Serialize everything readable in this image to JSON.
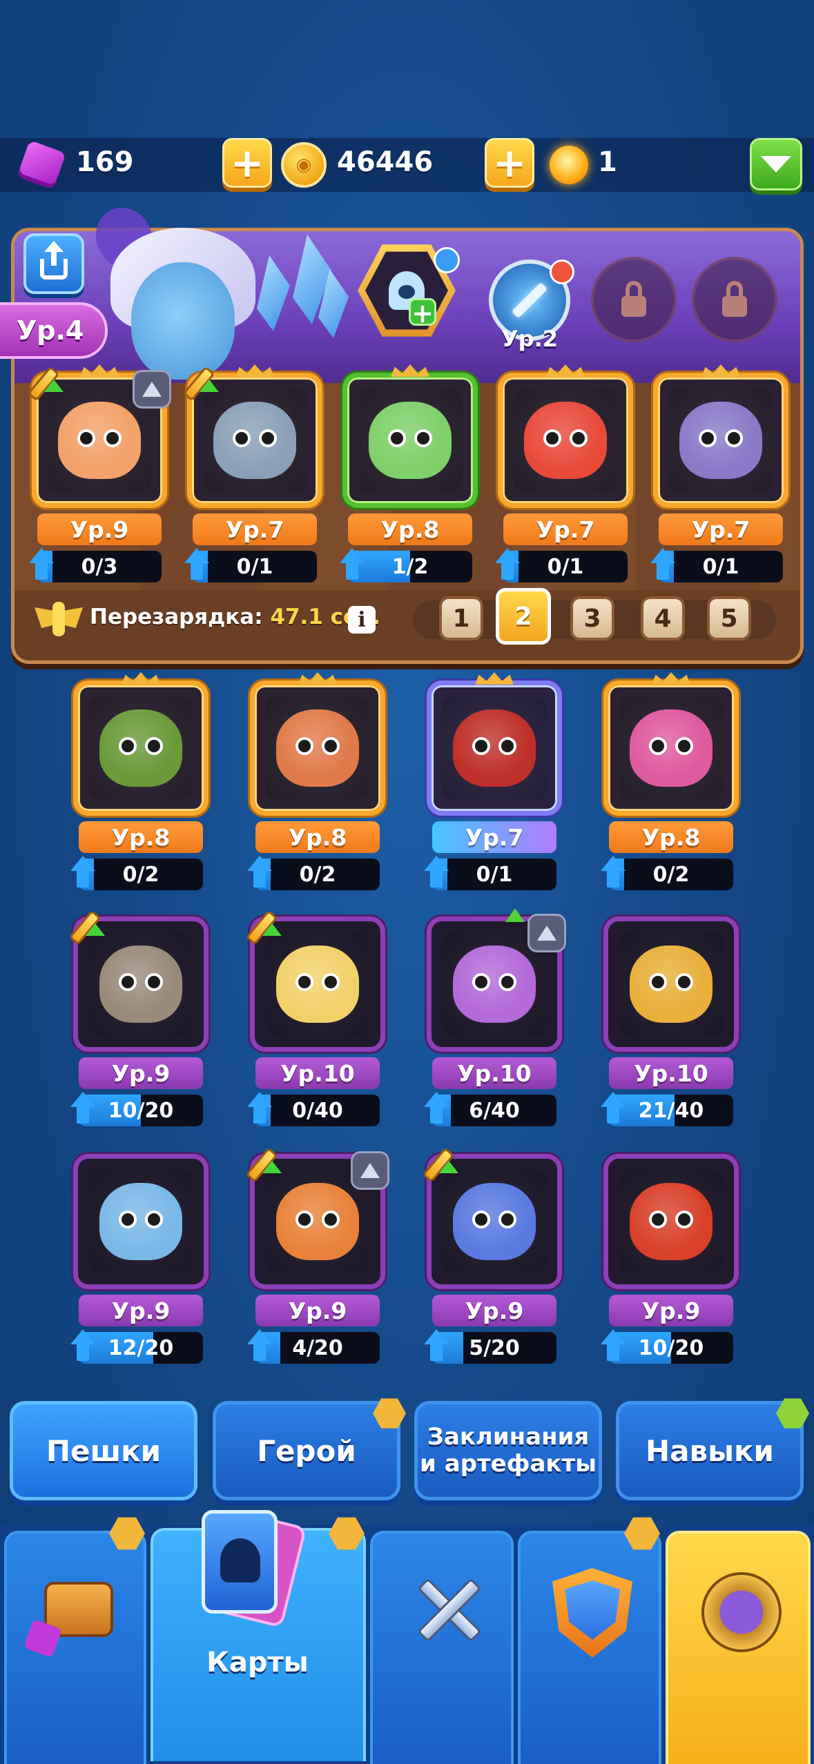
{
  "resources": {
    "gems": "169",
    "coins": "46446",
    "potions": "1"
  },
  "icons": {
    "gem": "gem-icon",
    "coin": "coin-icon",
    "potion": "potion-icon",
    "menu": "chevron-down-icon",
    "share": "share-icon",
    "lock": "lock-icon",
    "cooldown": "winged-emblem-icon"
  },
  "hero": {
    "level": "Ур.4",
    "slot_level": "Ур.2"
  },
  "deck_units": [
    {
      "level": "Ур.9",
      "progress": "0/3",
      "fraction": 0.0,
      "frame": "orange"
    },
    {
      "level": "Ур.7",
      "progress": "0/1",
      "fraction": 0.0,
      "frame": "orange"
    },
    {
      "level": "Ур.8",
      "progress": "1/2",
      "fraction": 0.5,
      "frame": "green"
    },
    {
      "level": "Ур.7",
      "progress": "0/1",
      "fraction": 0.0,
      "frame": "orange"
    },
    {
      "level": "Ур.7",
      "progress": "0/1",
      "fraction": 0.0,
      "frame": "orange"
    }
  ],
  "cooldown": {
    "label": "Перезарядка:",
    "value": "47.1 сек.",
    "info": "i"
  },
  "deck_tabs": [
    "1",
    "2",
    "3",
    "4",
    "5"
  ],
  "active_deck_tab": "2",
  "collection": [
    [
      {
        "level": "Ур.8",
        "progress": "0/2",
        "fraction": 0.0,
        "frame": "orange"
      },
      {
        "level": "Ур.8",
        "progress": "0/2",
        "fraction": 0.0,
        "frame": "orange"
      },
      {
        "level": "Ур.7",
        "progress": "0/1",
        "fraction": 0.0,
        "frame": "blue"
      },
      {
        "level": "Ур.8",
        "progress": "0/2",
        "fraction": 0.0,
        "frame": "orange"
      }
    ],
    [
      {
        "level": "Ур.9",
        "progress": "10/20",
        "fraction": 0.5,
        "frame": "purple"
      },
      {
        "level": "Ур.10",
        "progress": "0/40",
        "fraction": 0.0,
        "frame": "purple"
      },
      {
        "level": "Ур.10",
        "progress": "6/40",
        "fraction": 0.15,
        "frame": "purple"
      },
      {
        "level": "Ур.10",
        "progress": "21/40",
        "fraction": 0.525,
        "frame": "purple"
      }
    ],
    [
      {
        "level": "Ур.9",
        "progress": "12/20",
        "fraction": 0.6,
        "frame": "purple"
      },
      {
        "level": "Ур.9",
        "progress": "4/20",
        "fraction": 0.2,
        "frame": "purple"
      },
      {
        "level": "Ур.9",
        "progress": "5/20",
        "fraction": 0.25,
        "frame": "purple"
      },
      {
        "level": "Ур.9",
        "progress": "10/20",
        "fraction": 0.5,
        "frame": "purple"
      }
    ]
  ],
  "section_tabs": {
    "pawns": "Пешки",
    "hero": "Герой",
    "spells_line1": "Заклинания",
    "spells_line2": "и артефакты",
    "skills": "Навыки"
  },
  "bottom_nav": {
    "cards_label": "Карты"
  },
  "colors": {
    "accent_orange": "#f07a1a",
    "accent_purple": "#8a3ab0",
    "progress_blue": "#2fa6ff",
    "button_blue": "#1b6fe0",
    "gold": "#f6b01c"
  }
}
